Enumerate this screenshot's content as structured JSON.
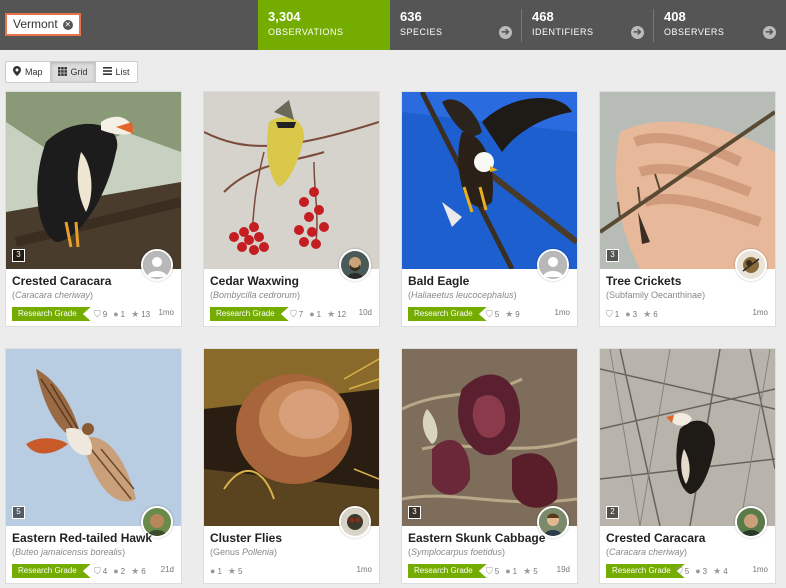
{
  "place_filter": {
    "label": "Vermont"
  },
  "stats": [
    {
      "value": "3,304",
      "label": "OBSERVATIONS"
    },
    {
      "value": "636",
      "label": "SPECIES"
    },
    {
      "value": "468",
      "label": "IDENTIFIERS"
    },
    {
      "value": "408",
      "label": "OBSERVERS"
    }
  ],
  "view_toggle": [
    {
      "label": "Map",
      "icon": "map-marker-icon"
    },
    {
      "label": "Grid",
      "icon": "grid-icon",
      "active": true
    },
    {
      "label": "List",
      "icon": "list-icon"
    }
  ],
  "colors": {
    "accent": "#74ac00",
    "topbar": "#555555",
    "place_border": "#e8734a"
  },
  "cards": [
    {
      "name": "Crested Caracara",
      "sci": "(",
      "sci_name": "Caracara cheriway",
      "sci_end": ")",
      "italic": true,
      "grade": "Research Grade",
      "ids": "9",
      "comments": "1",
      "faves": "13",
      "age": "1mo",
      "photos": "3"
    },
    {
      "name": "Cedar Waxwing",
      "sci": "(",
      "sci_name": "Bombycilla cedrorum",
      "sci_end": ")",
      "italic": true,
      "grade": "Research Grade",
      "ids": "7",
      "comments": "1",
      "faves": "12",
      "age": "10d",
      "photos": ""
    },
    {
      "name": "Bald Eagle",
      "sci": "(",
      "sci_name": "Haliaeetus leucocephalus",
      "sci_end": ")",
      "italic": true,
      "grade": "Research Grade",
      "ids": "5",
      "comments": "",
      "faves": "9",
      "age": "1mo",
      "photos": ""
    },
    {
      "name": "Tree Crickets",
      "sci": "(Subfamily ",
      "sci_name": "Oecanthinae",
      "sci_end": ")",
      "italic": false,
      "grade": "",
      "ids": "1",
      "comments": "3",
      "faves": "6",
      "age": "1mo",
      "photos": "3"
    },
    {
      "name": "Eastern Red-tailed Hawk",
      "sci": "(",
      "sci_name": "Buteo jamaicensis borealis",
      "sci_end": ")",
      "italic": true,
      "grade": "Research Grade",
      "ids": "4",
      "comments": "2",
      "faves": "6",
      "age": "21d",
      "photos": "5"
    },
    {
      "name": "Cluster Flies",
      "sci": "(Genus ",
      "sci_name": "Pollenia",
      "sci_end": ")",
      "italic": true,
      "grade": "",
      "ids": "",
      "comments": "1",
      "faves": "5",
      "age": "1mo",
      "photos": ""
    },
    {
      "name": "Eastern Skunk Cabbage",
      "sci": "(",
      "sci_name": "Symplocarpus foetidus",
      "sci_end": ")",
      "italic": true,
      "grade": "Research Grade",
      "ids": "5",
      "comments": "1",
      "faves": "5",
      "age": "19d",
      "photos": "3"
    },
    {
      "name": "Crested Caracara",
      "sci": "(",
      "sci_name": "Caracara cheriway",
      "sci_end": ")",
      "italic": true,
      "grade": "Research Grade",
      "ids": "5",
      "comments": "3",
      "faves": "4",
      "age": "1mo",
      "photos": "2"
    }
  ]
}
